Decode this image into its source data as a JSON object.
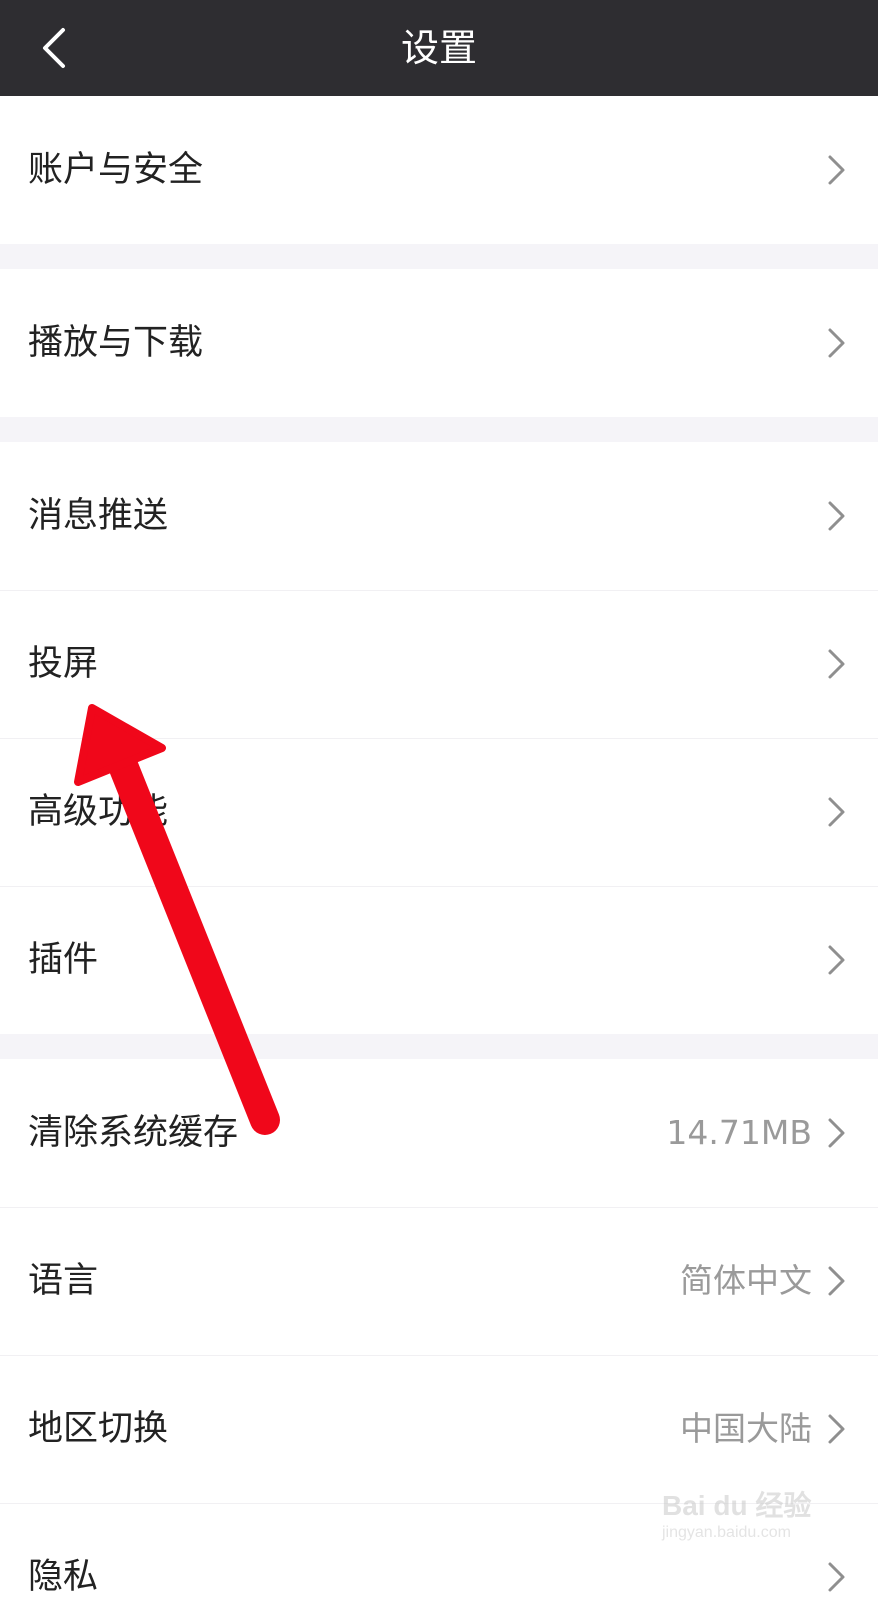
{
  "header": {
    "title": "设置"
  },
  "groups": [
    {
      "items": [
        {
          "label": "账户与安全",
          "value": ""
        }
      ]
    },
    {
      "items": [
        {
          "label": "播放与下载",
          "value": ""
        }
      ]
    },
    {
      "items": [
        {
          "label": "消息推送",
          "value": ""
        },
        {
          "label": "投屏",
          "value": ""
        },
        {
          "label": "高级功能",
          "value": ""
        },
        {
          "label": "插件",
          "value": ""
        }
      ]
    },
    {
      "items": [
        {
          "label": "清除系统缓存",
          "value": "14.71MB"
        },
        {
          "label": "语言",
          "value": "简体中文"
        },
        {
          "label": "地区切换",
          "value": "中国大陆"
        },
        {
          "label": "隐私",
          "value": ""
        }
      ]
    }
  ],
  "watermark": {
    "brand": "Bai du 经验",
    "url": "jingyan.baidu.com"
  },
  "colors": {
    "header_bg": "#2e2d31",
    "arrow": "#f0071a",
    "background": "#f5f4f8"
  }
}
